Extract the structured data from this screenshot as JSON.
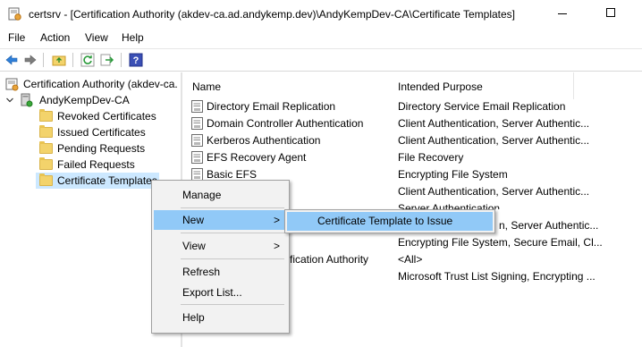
{
  "window": {
    "title": "certsrv - [Certification Authority (akdev-ca.ad.andykemp.dev)\\AndyKempDev-CA\\Certificate Templates]"
  },
  "menubar": {
    "items": [
      "File",
      "Action",
      "View",
      "Help"
    ]
  },
  "toolbar": {
    "buttons": [
      "back-arrow-icon",
      "forward-arrow-icon",
      "up-folder-icon",
      "refresh-icon",
      "export-list-icon",
      "help-icon"
    ]
  },
  "tree": {
    "root": "Certification Authority (akdev-ca.",
    "ca": "AndyKempDev-CA",
    "folders": [
      "Revoked Certificates",
      "Issued Certificates",
      "Pending Requests",
      "Failed Requests",
      "Certificate Templates"
    ]
  },
  "list": {
    "columns": {
      "name": "Name",
      "purpose": "Intended Purpose"
    },
    "rows": [
      {
        "name": "Directory Email Replication",
        "purpose": "Directory Service Email Replication"
      },
      {
        "name": "Domain Controller Authentication",
        "purpose": "Client Authentication, Server Authentic..."
      },
      {
        "name": "Kerberos Authentication",
        "purpose": "Client Authentication, Server Authentic..."
      },
      {
        "name": "EFS Recovery Agent",
        "purpose": "File Recovery"
      },
      {
        "name": "Basic EFS",
        "purpose": "Encrypting File System"
      },
      {
        "name": "er",
        "purpose": "Client Authentication, Server Authentic..."
      },
      {
        "name": "",
        "purpose": "Server Authentication"
      },
      {
        "name": "",
        "purpose": "n, Server Authentic..."
      },
      {
        "name": "",
        "purpose": "Encrypting File System, Secure Email, Cl..."
      },
      {
        "name": "fication Authority",
        "purpose": "<All>"
      },
      {
        "name": "",
        "purpose": "Microsoft Trust List Signing, Encrypting ..."
      }
    ]
  },
  "context_menu": {
    "items": {
      "manage": "Manage",
      "new": "New",
      "view": "View",
      "refresh": "Refresh",
      "export": "Export List...",
      "help": "Help"
    },
    "arrow": ">",
    "submenu_item": "Certificate Template to Issue"
  },
  "colors": {
    "selection": "#cce8ff",
    "menu_hover": "#91c9f7",
    "menu_bg": "#f2f2f2"
  }
}
